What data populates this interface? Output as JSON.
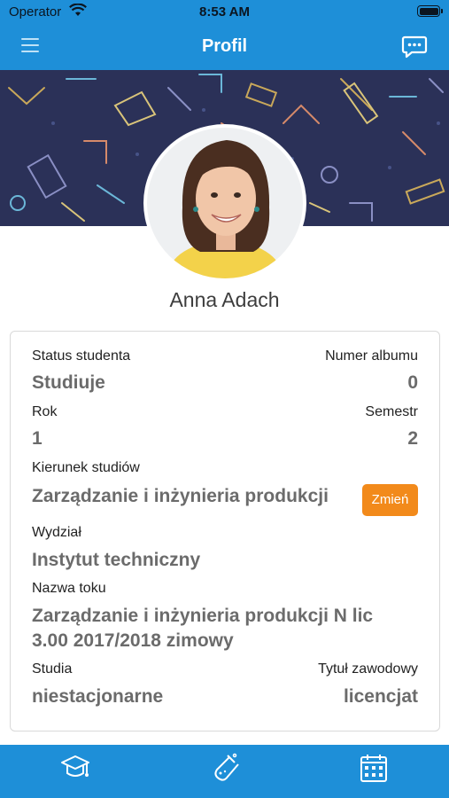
{
  "status_bar": {
    "carrier": "Operator",
    "time": "8:53 AM"
  },
  "header": {
    "title": "Profil",
    "menu_icon": "hamburger-icon",
    "chat_icon": "chat-icon"
  },
  "profile": {
    "name": "Anna Adach"
  },
  "details": {
    "status_label": "Status studenta",
    "status_value": "Studiuje",
    "album_label": "Numer albumu",
    "album_value": "0",
    "year_label": "Rok",
    "year_value": "1",
    "semester_label": "Semestr",
    "semester_value": "2",
    "field_label": "Kierunek studiów",
    "field_value": "Zarządzanie i inżynieria produkcji",
    "change_button": "Zmień",
    "faculty_label": "Wydział",
    "faculty_value": "Instytut techniczny",
    "course_label": "Nazwa toku",
    "course_value_line1": "Zarządzanie i inżynieria produkcji N lic",
    "course_value_line2": "3.00 2017/2018 zimowy",
    "studies_label": "Studia",
    "studies_value": "niestacjonarne",
    "title_label": "Tytuł zawodowy",
    "title_value": "licencjat"
  },
  "tabbar": {
    "items": [
      {
        "icon": "graduation-cap-icon"
      },
      {
        "icon": "lab-flask-icon"
      },
      {
        "icon": "calendar-icon"
      }
    ]
  },
  "colors": {
    "primary": "#1e8fd8",
    "accent": "#f28a1b",
    "banner": "#2b3158"
  }
}
